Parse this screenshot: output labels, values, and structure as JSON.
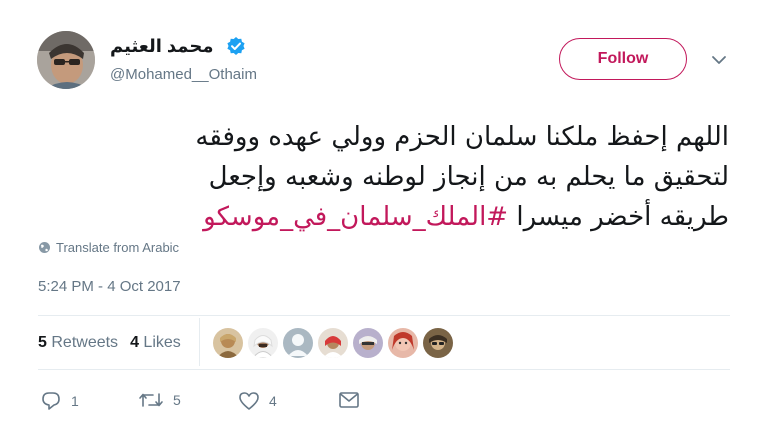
{
  "user": {
    "display_name": "محمد العثيم",
    "handle": "@Mohamed__Othaim",
    "verified": true,
    "avatar_icon": "user-avatar-photo"
  },
  "header": {
    "follow_label": "Follow",
    "menu_icon": "chevron-down-icon",
    "accent_color": "#c2185b"
  },
  "tweet": {
    "line1": "اللهم إحفظ ملكنا سلمان الحزم وولي عهده ووفقه",
    "line2": "لتحقيق ما يحلم به من إنجاز  لوطنه وشعبه وإجعل",
    "line3_text": "طريقه أخضر ميسرا ",
    "hashtag": "#الملك_سلمان_في_موسكو"
  },
  "translate_label": "Translate from Arabic",
  "timestamp": "5:24 PM - 4 Oct 2017",
  "stats": {
    "retweets_count": "5",
    "retweets_label": "Retweets",
    "likes_count": "4",
    "likes_label": "Likes"
  },
  "likers": [
    {
      "icon": "liker-avatar-1",
      "color": "#b88a55"
    },
    {
      "icon": "liker-avatar-2",
      "color": "#e8e8e8"
    },
    {
      "icon": "liker-avatar-default",
      "color": "#aab8c2"
    },
    {
      "icon": "liker-avatar-4",
      "color": "#d9c7b2"
    },
    {
      "icon": "liker-avatar-5",
      "color": "#8a7ea6"
    },
    {
      "icon": "liker-avatar-6",
      "color": "#c98c7a"
    },
    {
      "icon": "liker-avatar-7",
      "color": "#6e5a3e"
    }
  ],
  "actions": {
    "reply_count": "1",
    "retweet_count": "5",
    "like_count": "4"
  }
}
